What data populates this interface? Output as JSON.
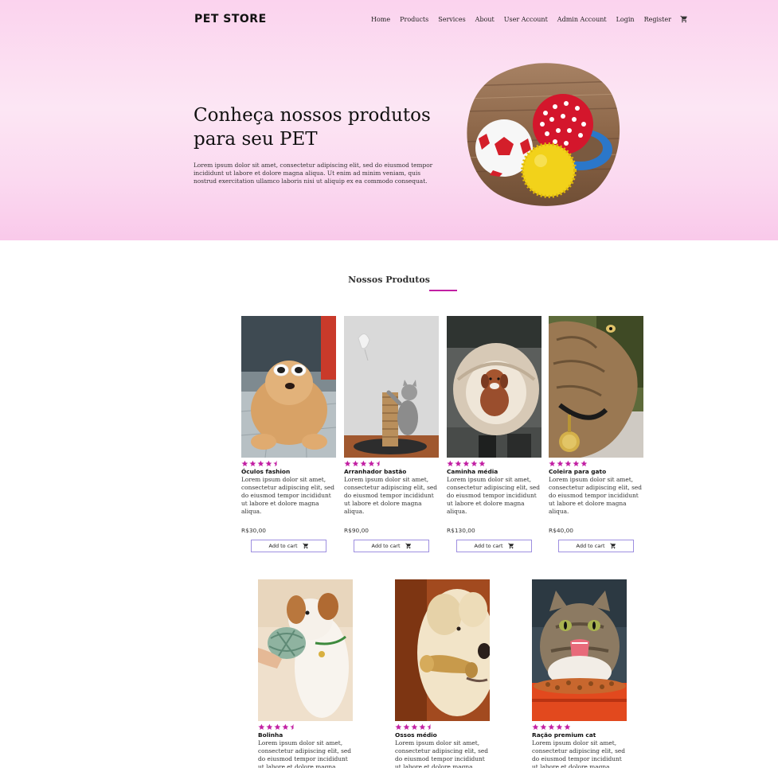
{
  "brand": "PET STORE",
  "nav": [
    "Home",
    "Products",
    "Services",
    "About",
    "User Account",
    "Admin Account",
    "Login",
    "Register"
  ],
  "hero": {
    "title": "Conheça nossos produtos para seu PET",
    "text": "Lorem ipsum dolor sit amet, consectetur adipiscing elit, sed do eiusmod tempor incididunt ut labore et dolore magna aliqua. Ut enim ad minim veniam, quis nostrud exercitation ullamco laboris nisi ut aliquip ex ea commodo consequat."
  },
  "section_title": "Nossos Produtos",
  "add_to_cart_label": "Add to cart",
  "accent_color": "#c21fa3",
  "products": [
    {
      "name": "Óculos fashion",
      "rating": 4.5,
      "desc": "Lorem ipsum dolor sit amet, consectetur adipiscing elit, sed do eiusmod tempor incididunt ut labore et dolore magna aliqua.",
      "price": "R$30,00"
    },
    {
      "name": "Arranhador bastão",
      "rating": 4.5,
      "desc": "Lorem ipsum dolor sit amet, consectetur adipiscing elit, sed do eiusmod tempor incididunt ut labore et dolore magna aliqua.",
      "price": "R$90,00"
    },
    {
      "name": "Caminha média",
      "rating": 5,
      "desc": "Lorem ipsum dolor sit amet, consectetur adipiscing elit, sed do eiusmod tempor incididunt ut labore et dolore magna aliqua.",
      "price": "R$130,00"
    },
    {
      "name": "Coleira para gato",
      "rating": 5,
      "desc": "Lorem ipsum dolor sit amet, consectetur adipiscing elit, sed do eiusmod tempor incididunt ut labore et dolore magna aliqua.",
      "price": "R$40,00"
    },
    {
      "name": "Bolinha",
      "rating": 4.5,
      "desc": "Lorem ipsum dolor sit amet, consectetur adipiscing elit, sed do eiusmod tempor incididunt ut labore et dolore magna aliqua.",
      "price": ""
    },
    {
      "name": "Ossos médio",
      "rating": 4.5,
      "desc": "Lorem ipsum dolor sit amet, consectetur adipiscing elit, sed do eiusmod tempor incididunt ut labore et dolore magna aliqua.",
      "price": ""
    },
    {
      "name": "Ração premium cat",
      "rating": 5,
      "desc": "Lorem ipsum dolor sit amet, consectetur adipiscing elit, sed do eiusmod tempor incididunt ut labore et dolore magna aliqua.",
      "price": ""
    }
  ]
}
